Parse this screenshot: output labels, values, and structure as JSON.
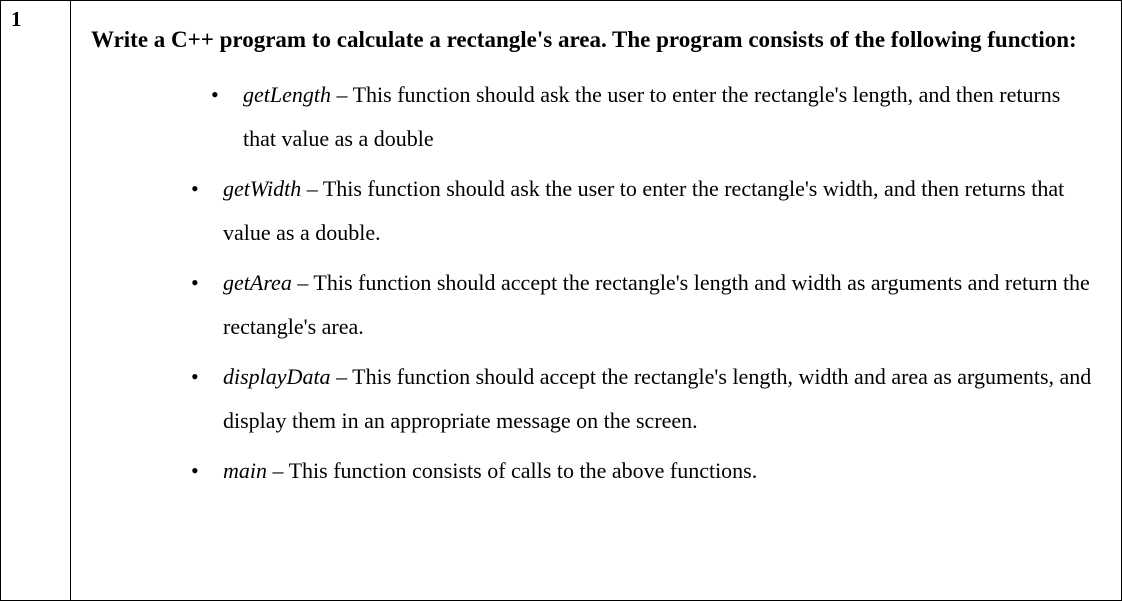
{
  "question_number": "1",
  "heading": "Write a C++ program to calculate a rectangle's area. The program consists of the following function:",
  "functions": [
    {
      "name": "getLength",
      "desc": " – This function should ask the user to enter the rectangle's length, and then returns that value as a double"
    },
    {
      "name": "getWidth",
      "desc": " – This function should ask the user to enter the rectangle's width, and then returns that value as a double."
    },
    {
      "name": "getArea",
      "desc": " – This function should accept the rectangle's length and width as arguments and return the rectangle's area."
    },
    {
      "name": "displayData",
      "desc": " – This function should accept the rectangle's length, width and area as arguments, and display them in an appropriate message on the screen."
    },
    {
      "name": "main",
      "desc": " – This function consists of calls to the above functions."
    }
  ]
}
